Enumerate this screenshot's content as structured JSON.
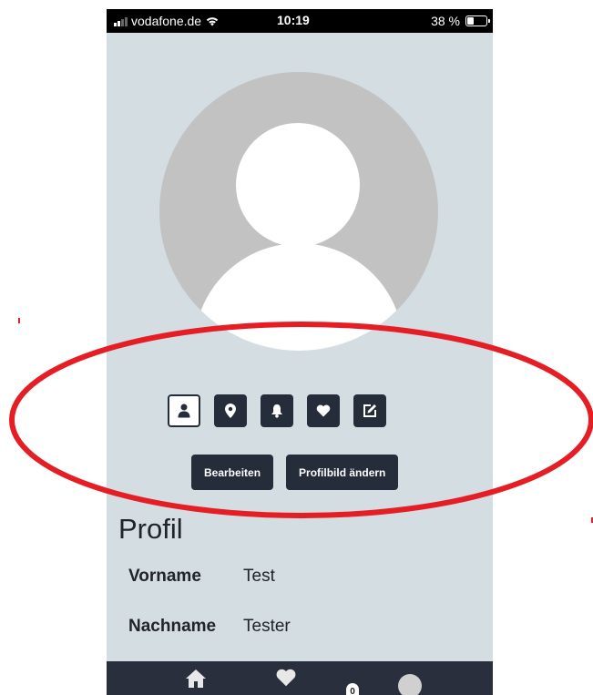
{
  "status_bar": {
    "carrier": "vodafone.de",
    "time": "10:19",
    "battery": "38 %",
    "battery_level": 0.38
  },
  "profile_image": {
    "icon": "default-user-avatar"
  },
  "action_icons": [
    {
      "name": "profile-icon",
      "icon": "user",
      "active": true
    },
    {
      "name": "location-icon",
      "icon": "map-pin"
    },
    {
      "name": "notification-bell-icon",
      "icon": "bell"
    },
    {
      "name": "favorites-heart-icon",
      "icon": "heart"
    },
    {
      "name": "edit-icon",
      "icon": "pencil-square"
    }
  ],
  "buttons": {
    "edit": "Bearbeiten",
    "change_picture": "Profilbild ändern"
  },
  "profile": {
    "title": "Profil",
    "first_name_label": "Vorname",
    "first_name_value": "Test",
    "last_name_label": "Nachname",
    "last_name_value": "Tester"
  },
  "bottom_nav": {
    "items": [
      "home-icon",
      "heart-icon",
      "badge",
      "avatar"
    ],
    "badge_count": "0"
  },
  "annotation": {
    "color": "#e41e24",
    "shape": "ellipse"
  },
  "colors": {
    "background": "#d3dde2",
    "button": "#252c3a",
    "nav": "#2a2f3d"
  }
}
